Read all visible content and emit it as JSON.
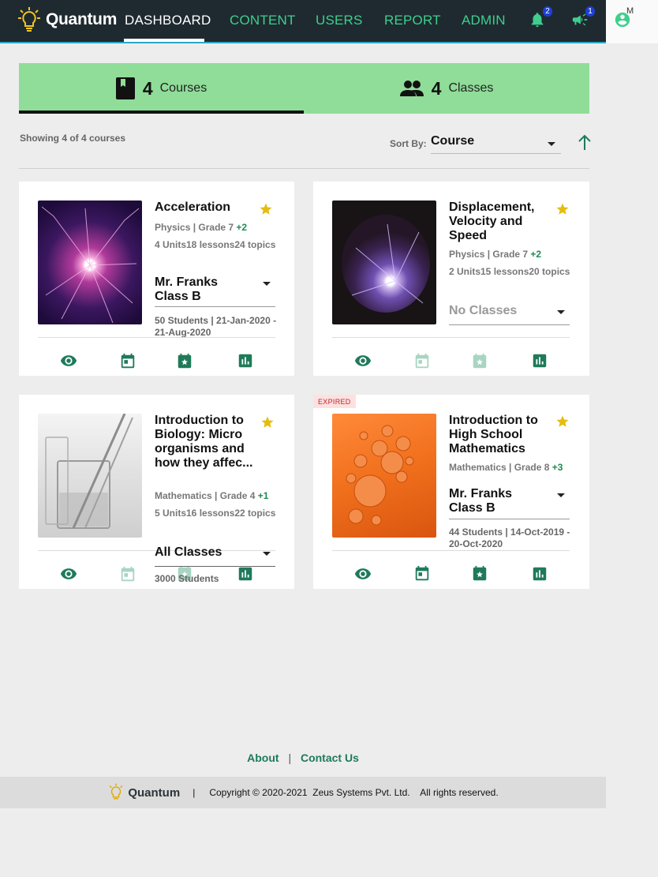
{
  "nav": {
    "brand": "Quantum",
    "items": [
      "DASHBOARD",
      "CONTENT",
      "USERS",
      "REPORT",
      "ADMIN"
    ],
    "notifications_count": "2",
    "announcements_count": "1",
    "user_initial": "M",
    "accent_color": "#3ecf8e"
  },
  "summary": {
    "courses": {
      "count": "4",
      "label": "Courses"
    },
    "classes": {
      "count": "4",
      "label": "Classes"
    }
  },
  "toolbar": {
    "showing_text": "Showing 4 of 4 courses",
    "sort_label": "Sort By:",
    "sort_value": "Course"
  },
  "courses": [
    {
      "title": "Acceleration",
      "subject_grade": "Physics | Grade 7",
      "extra": "+2",
      "stats": "4 Units18 lessons24 topics",
      "class_value": "Mr. Franks Class B",
      "students": "50 Students | 21-Jan-2020 - 21-Aug-2020"
    },
    {
      "title": "Displacement, Velocity and Speed",
      "subject_grade": "Physics | Grade 7",
      "extra": "+2",
      "stats": "2 Units15 lessons20 topics",
      "class_value": "No Classes",
      "students": ""
    },
    {
      "title": "Introduction to Biology: Micro organisms and how they affec...",
      "subject_grade": "Mathematics | Grade 4",
      "extra": "+1",
      "stats": "5 Units16 lessons22 topics",
      "class_value": "All Classes",
      "students": "3000 Students"
    },
    {
      "badge": "EXPIRED",
      "title": "Introduction to High School Mathematics",
      "subject_grade": "Mathematics | Grade 8",
      "extra": "+3",
      "stats": "",
      "class_value": "Mr. Franks Class B",
      "students": "44 Students | 14-Oct-2019 - 20-Oct-2020"
    }
  ],
  "footer": {
    "about": "About",
    "contact": "Contact Us",
    "pipe": "|",
    "brand": "Quantum",
    "copyright": "Copyright © 2020-2021  Zeus Systems Pvt. Ltd.    All rights reserved."
  }
}
